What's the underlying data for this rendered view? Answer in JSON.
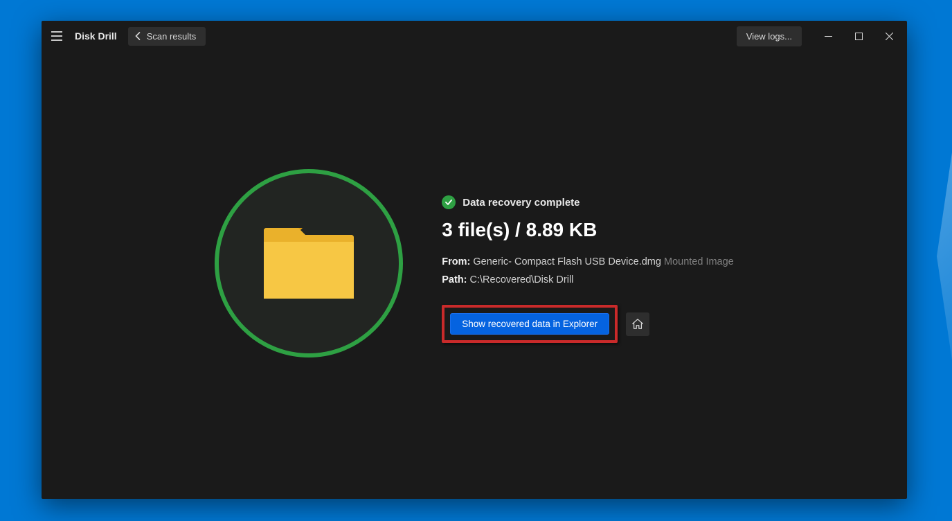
{
  "app": {
    "title": "Disk Drill",
    "back_label": "Scan results",
    "view_logs_label": "View logs..."
  },
  "status": {
    "heading": "Data recovery complete",
    "stats": "3 file(s) / 8.89 KB"
  },
  "from": {
    "label": "From:",
    "value": "Generic- Compact Flash USB Device.dmg",
    "suffix": "Mounted Image"
  },
  "path": {
    "label": "Path:",
    "value": "C:\\Recovered\\Disk Drill"
  },
  "actions": {
    "show_in_explorer": "Show recovered data in Explorer"
  },
  "colors": {
    "accent_green": "#2ea043",
    "primary_blue": "#0563e0",
    "highlight_red": "#c92a2a"
  }
}
